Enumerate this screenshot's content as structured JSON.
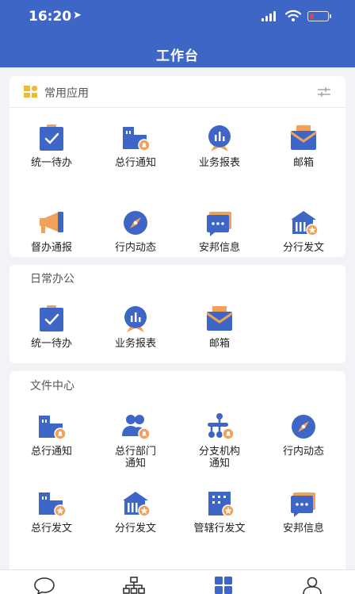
{
  "status": {
    "time": "16:20",
    "location_glyph": "➤"
  },
  "header": {
    "title": "工作台"
  },
  "sections": {
    "common": {
      "title": "常用应用",
      "apps": [
        "统一待办",
        "总行通知",
        "业务报表",
        "邮箱",
        "督办通报",
        "行内动态",
        "安邦信息",
        "分行发文"
      ]
    },
    "daily": {
      "title": "日常办公",
      "apps": [
        "统一待办",
        "业务报表",
        "邮箱"
      ]
    },
    "files": {
      "title": "文件中心",
      "apps": [
        "总行通知",
        "总行部门\n通知",
        "分支机构\n通知",
        "行内动态",
        "总行发文",
        "分行发文",
        "管辖行发文",
        "安邦信息"
      ]
    }
  },
  "colors": {
    "primary": "#3e66c6",
    "orange": "#f0a25a",
    "bg": "#f2f3f7"
  },
  "icons": {
    "common": [
      "todo-icon",
      "head-office-notice-icon",
      "report-icon",
      "mailbox-icon",
      "supervision-icon",
      "news-compass-icon",
      "info-chat-icon",
      "branch-doc-icon"
    ],
    "daily": [
      "todo-icon",
      "report-icon",
      "mailbox-icon"
    ],
    "files": [
      "head-office-notice-icon",
      "department-notice-icon",
      "branch-org-notice-icon",
      "news-compass-icon",
      "head-office-doc-icon",
      "branch-doc-icon",
      "jurisdiction-doc-icon",
      "info-chat-icon"
    ],
    "tabs": [
      "message-icon",
      "org-chart-icon",
      "workbench-icon",
      "profile-icon"
    ]
  }
}
